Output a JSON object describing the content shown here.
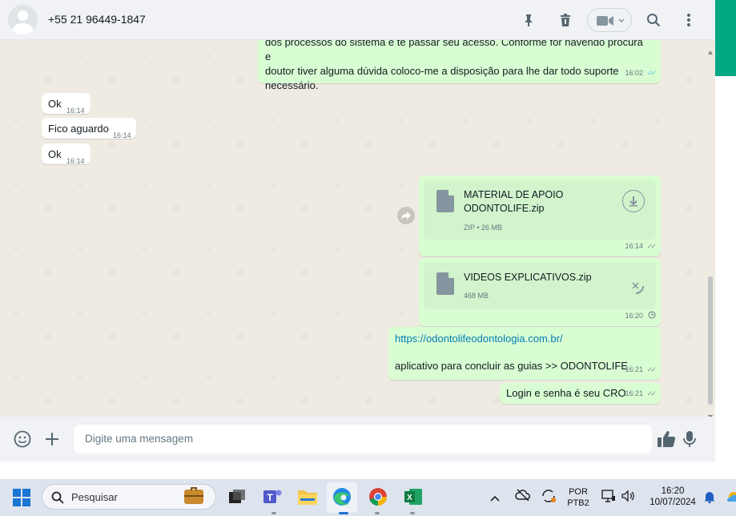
{
  "header": {
    "contact_name": "+55 21 96449-1847"
  },
  "messages": {
    "top_out": {
      "lines": [
        "dos processos do sistema e te passar seu acesso. Conforme for havendo procura e",
        "doutor tiver alguma dúvida coloco-me a disposição para lhe dar todo suporte",
        "necessário."
      ],
      "time": "16:02"
    },
    "in": [
      {
        "text": "Ok",
        "time": "16:14"
      },
      {
        "text": "Fico aguardo",
        "time": "16:14"
      },
      {
        "text": "Ok",
        "time": "16:14"
      }
    ],
    "file1": {
      "name_line1": "MATERIAL DE APOIO",
      "name_line2": "ODONTOLIFE.zip",
      "meta": "ZIP • 26 MB",
      "time": "16:14"
    },
    "file2": {
      "name": "VIDEOS EXPLICATIVOS.zip",
      "meta": "468 MB",
      "time": "16:20"
    },
    "link_msg": {
      "link": "https://odontolifeodontologia.com.br/",
      "text": "aplicativo para concluir as guias >> ODONTOLIFE",
      "time": "16:21"
    },
    "last_out": {
      "text": "Login e senha é seu CRO",
      "time": "16:21"
    }
  },
  "composer": {
    "placeholder": "Digite uma mensagem"
  },
  "taskbar": {
    "search_label": "Pesquisar",
    "lang_top": "POR",
    "lang_bottom": "PTB2",
    "clock_time": "16:20",
    "clock_date": "10/07/2024"
  },
  "colors": {
    "outgoing": "#d9fdd3",
    "incoming": "#ffffff",
    "accent": "#00a884",
    "read_tick": "#53bdeb"
  },
  "icons": [
    "pin-icon",
    "trash-icon",
    "video-icon",
    "search-icon",
    "menu-icon",
    "emoji-icon",
    "plus-icon",
    "like-icon",
    "mic-icon",
    "download-icon",
    "forward-icon",
    "cancel-icon",
    "clock-icon"
  ]
}
